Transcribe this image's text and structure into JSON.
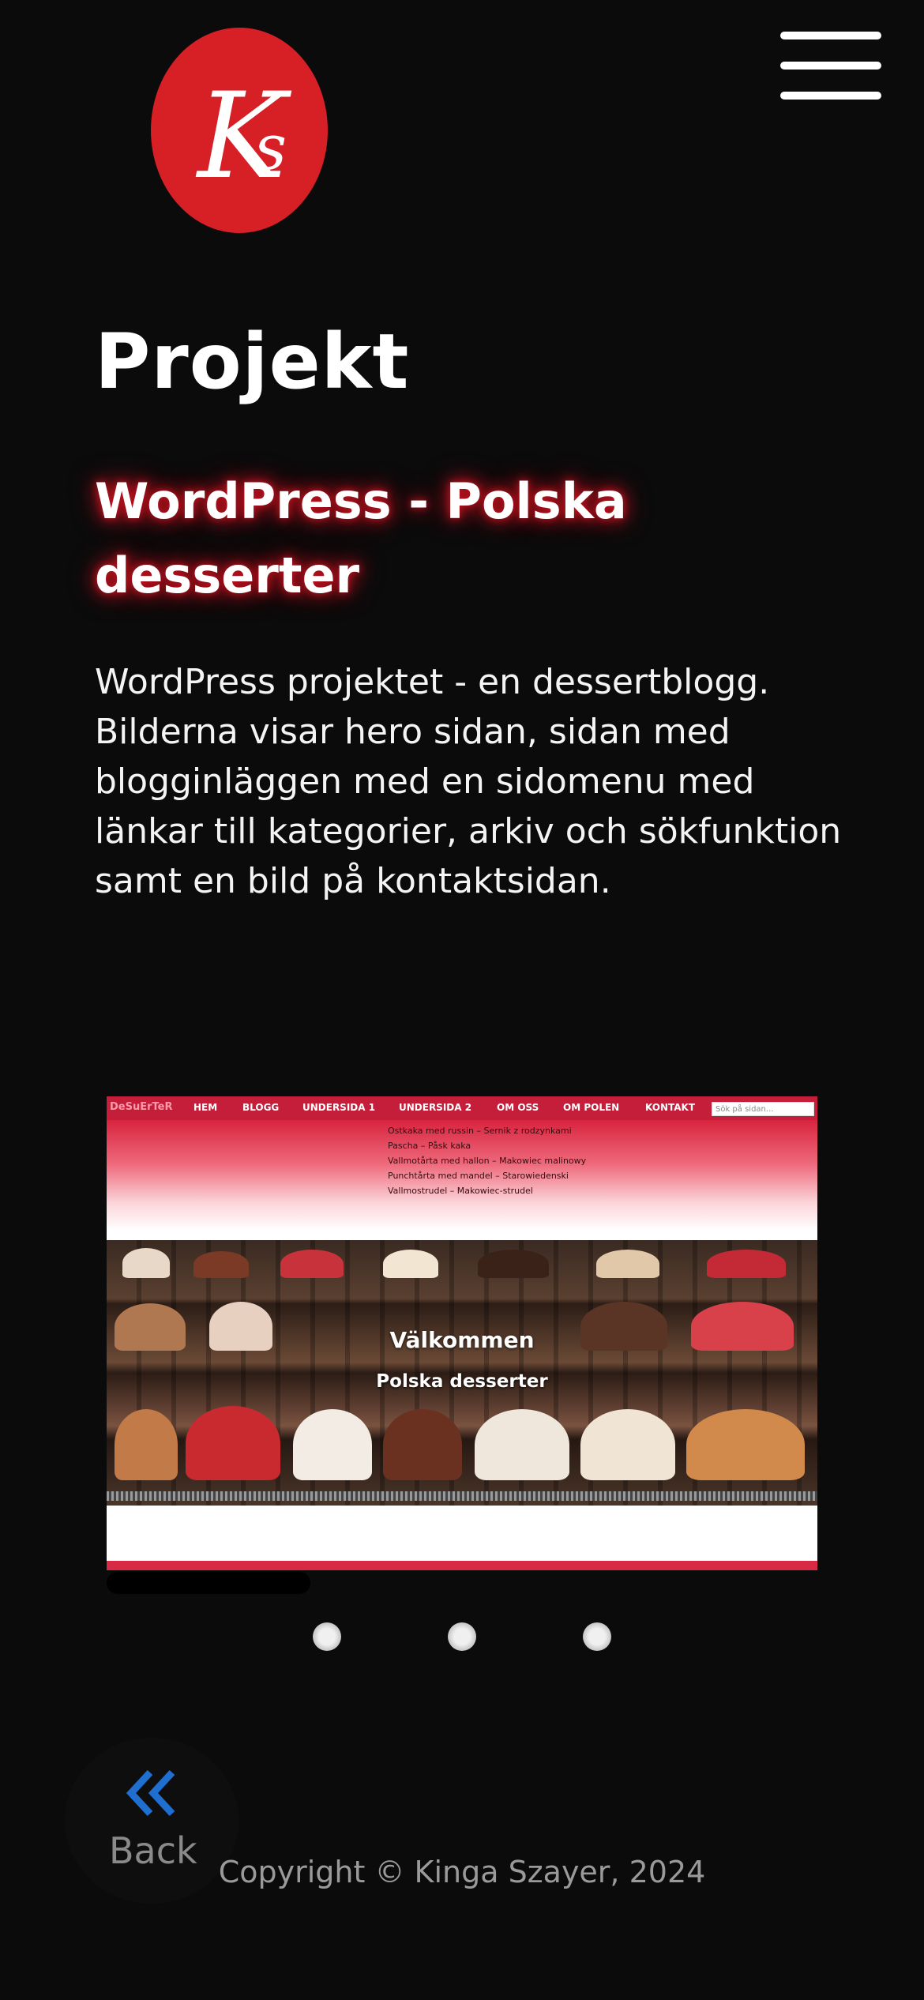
{
  "header": {
    "logo_text": "Ks",
    "logo_color": "#d71f26",
    "menu_icon": "hamburger-menu-icon"
  },
  "main": {
    "page_title": "Projekt",
    "project_title": "WordPress - Polska desserter",
    "description": "WordPress projektet - en dessertblogg. Bilderna visar hero sidan, sidan med blogginläggen med en sidomenu med länkar till kategorier, arkiv och sökfunktion samt en bild på kontaktsidan."
  },
  "slide": {
    "brand": "DeSuErTeR",
    "nav": [
      "HEM",
      "BLOGG",
      "UNDERSIDA 1",
      "UNDERSIDA 2",
      "OM OSS",
      "OM POLEN",
      "KONTAKT"
    ],
    "search_placeholder": "Sök på sidan...",
    "dropdown": [
      "Ostkaka med russin – Sernik z rodzynkami",
      "Pascha – Påsk kaka",
      "Vallmotårta med hallon – Makowiec malinowy",
      "Punchtårta med mandel – Starowiedenski",
      "Vallmostrudel – Makowiec-strudel"
    ],
    "hero_title": "Välkommen",
    "hero_subtitle": "Polska desserter"
  },
  "slider_dots": 3,
  "accent_color": "#c1121f",
  "back": {
    "label": "Back",
    "icon": "double-chevron-left-icon"
  },
  "footer": {
    "copyright": "Copyright © Kinga Szayer, 2024"
  }
}
